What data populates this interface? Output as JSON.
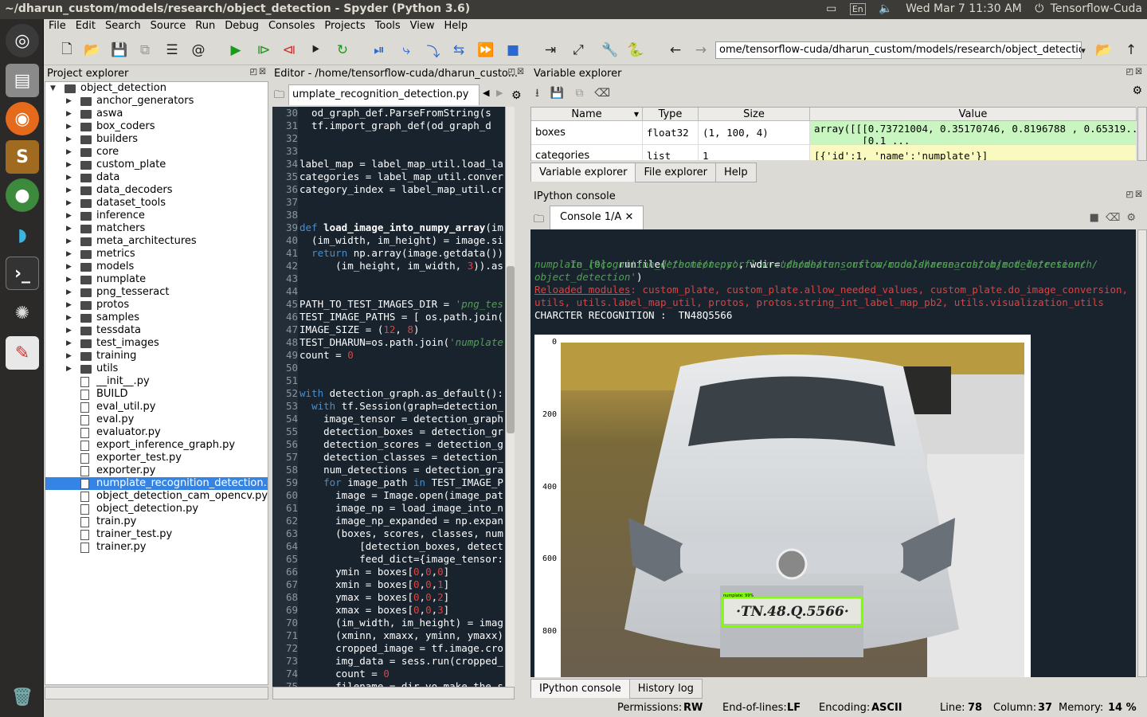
{
  "window": {
    "title": "~/dharun_custom/models/research/object_detection - Spyder (Python 3.6)"
  },
  "tray": {
    "keyboard": "En",
    "datetime": "Wed Mar  7 11:30 AM",
    "user": "Tensorflow-Cuda"
  },
  "menu": [
    "File",
    "Edit",
    "Search",
    "Source",
    "Run",
    "Debug",
    "Consoles",
    "Projects",
    "Tools",
    "View",
    "Help"
  ],
  "toolbar": {
    "path": "ome/tensorflow-cuda/dharun_custom/models/research/object_detection"
  },
  "project": {
    "title": "Project explorer",
    "root": "object_detection",
    "folders": [
      "anchor_generators",
      "aswa",
      "box_coders",
      "builders",
      "core",
      "custom_plate",
      "data",
      "data_decoders",
      "dataset_tools",
      "inference",
      "matchers",
      "meta_architectures",
      "metrics",
      "models",
      "numplate",
      "png_tesseract",
      "protos",
      "samples",
      "tessdata",
      "test_images",
      "training",
      "utils"
    ],
    "files": [
      "__init__.py",
      "BUILD",
      "eval_util.py",
      "eval.py",
      "evaluator.py",
      "export_inference_graph.py",
      "exporter_test.py",
      "exporter.py",
      "numplate_recognition_detection.py",
      "object_detection_cam_opencv.py",
      "object_detection.py",
      "train.py",
      "trainer_test.py",
      "trainer.py"
    ],
    "selected": "numplate_recognition_detection.py"
  },
  "editor": {
    "title": "Editor - /home/tensorflow-cuda/dharun_custo...",
    "tab": "umplate_recognition_detection.py",
    "lines": [
      {
        "n": "30",
        "t": "  od_graph_def.ParseFromString(s"
      },
      {
        "n": "31",
        "t": "  tf.import_graph_def(od_graph_d"
      },
      {
        "n": "32",
        "t": ""
      },
      {
        "n": "33",
        "t": ""
      },
      {
        "n": "34",
        "t": "label_map = label_map_util.load_la"
      },
      {
        "n": "35",
        "t": "categories = label_map_util.conver"
      },
      {
        "n": "36",
        "t": "category_index = label_map_util.cr"
      },
      {
        "n": "37",
        "t": ""
      },
      {
        "n": "38",
        "t": ""
      },
      {
        "n": "39",
        "t": "def load_image_into_numpy_array(im"
      },
      {
        "n": "40",
        "t": "  (im_width, im_height) = image.si"
      },
      {
        "n": "41",
        "t": "  return np.array(image.getdata())"
      },
      {
        "n": "42",
        "t": "      (im_height, im_width, 3)).as"
      },
      {
        "n": "43",
        "t": ""
      },
      {
        "n": "44",
        "t": ""
      },
      {
        "n": "45",
        "t": "PATH_TO_TEST_IMAGES_DIR = 'png_tes"
      },
      {
        "n": "46",
        "t": "TEST_IMAGE_PATHS = [ os.path.join("
      },
      {
        "n": "47",
        "t": "IMAGE_SIZE = (12, 8)"
      },
      {
        "n": "48",
        "t": "TEST_DHARUN=os.path.join('numplate"
      },
      {
        "n": "49",
        "t": "count = 0"
      },
      {
        "n": "50",
        "t": ""
      },
      {
        "n": "51",
        "t": ""
      },
      {
        "n": "52",
        "t": "with detection_graph.as_default():"
      },
      {
        "n": "53",
        "t": "  with tf.Session(graph=detection_"
      },
      {
        "n": "54",
        "t": "    image_tensor = detection_graph"
      },
      {
        "n": "55",
        "t": "    detection_boxes = detection_gr"
      },
      {
        "n": "56",
        "t": "    detection_scores = detection_g"
      },
      {
        "n": "57",
        "t": "    detection_classes = detection_"
      },
      {
        "n": "58",
        "t": "    num_detections = detection_gra"
      },
      {
        "n": "59",
        "t": "    for image_path in TEST_IMAGE_P"
      },
      {
        "n": "60",
        "t": "      image = Image.open(image_pat"
      },
      {
        "n": "61",
        "t": "      image_np = load_image_into_n"
      },
      {
        "n": "62",
        "t": "      image_np_expanded = np.expan"
      },
      {
        "n": "63",
        "t": "      (boxes, scores, classes, num"
      },
      {
        "n": "64",
        "t": "          [detection_boxes, detect"
      },
      {
        "n": "65",
        "t": "          feed_dict={image_tensor:"
      },
      {
        "n": "66",
        "t": "      ymin = boxes[0,0,0]"
      },
      {
        "n": "67",
        "t": "      xmin = boxes[0,0,1]"
      },
      {
        "n": "68",
        "t": "      ymax = boxes[0,0,2]"
      },
      {
        "n": "69",
        "t": "      xmax = boxes[0,0,3]"
      },
      {
        "n": "70",
        "t": "      (im_width, im_height) = imag"
      },
      {
        "n": "71",
        "t": "      (xminn, xmaxx, yminn, ymaxx)"
      },
      {
        "n": "72",
        "t": "      cropped_image = tf.image.cro"
      },
      {
        "n": "73",
        "t": "      img_data = sess.run(cropped_"
      },
      {
        "n": "74",
        "t": "      count = 0"
      },
      {
        "n": "75",
        "t": "      filename = dir_vo_make_the_s"
      }
    ]
  },
  "variable_explorer": {
    "title": "Variable explorer",
    "columns": [
      "Name",
      "Type",
      "Size",
      "Value"
    ],
    "rows": [
      {
        "name": "boxes",
        "type": "float32",
        "size": "(1, 100, 4)",
        "value": "array([[[0.73721004, 0.35170746, 0.8196788 , 0.65319...\n        [0.1 ...",
        "color": "#c8f5c0"
      },
      {
        "name": "categories",
        "type": "list",
        "size": "1",
        "value": "[{'id':1, 'name':'numplate'}]",
        "color": "#fafac0"
      }
    ],
    "tabs": [
      "Variable explorer",
      "File explorer",
      "Help"
    ]
  },
  "ipython": {
    "title": "IPython console",
    "tab": "Console 1/A",
    "prompt": "In [9]:",
    "cmd1": " runfile(",
    "path1": "'/home/tensorflow-cuda/dharun_custom/models/research/object_detection/",
    "path2": "numplate_recognition_detection.py'",
    "wdir_label": ", wdir=",
    "path3": "'/home/tensorflow-cuda/dharun_custom/models/research/",
    "path4": "object_detection'",
    "close": ")",
    "reloaded_label": "Reloaded modules",
    "reloaded1": ": custom_plate, custom_plate.allow_needed_values, custom_plate.do_image_conversion,",
    "reloaded2": "utils, utils.label_map_util, protos, protos.string_int_label_map_pb2, utils.visualization_utils",
    "output": "CHARCTER RECOGNITION :  TN48Q5566",
    "plate_text": "·TN.48.Q.5566·",
    "box_label": "numplate: 99%",
    "y_ticks": [
      "0",
      "200",
      "400",
      "600",
      "800"
    ],
    "tabs": [
      "IPython console",
      "History log"
    ]
  },
  "status": {
    "permissions_label": "Permissions:",
    "permissions": "RW",
    "eol_label": "End-of-lines:",
    "eol": "LF",
    "enc_label": "Encoding:",
    "enc": "ASCII",
    "line_label": "Line:",
    "line": "78",
    "col_label": "Column:",
    "col": "37",
    "mem_label": "Memory:",
    "mem": "14 %"
  }
}
